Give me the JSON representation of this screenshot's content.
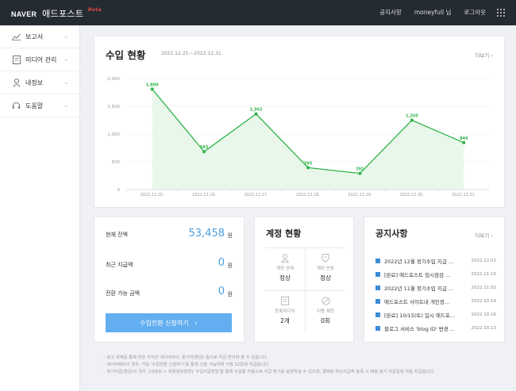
{
  "header": {
    "brand_naver": "NAVER",
    "brand_name": "애드포스트",
    "brand_beta": "Beta",
    "nav": [
      "공지사항",
      "moneyfull 님",
      "로그아웃"
    ]
  },
  "sidebar": {
    "items": [
      {
        "label": "보고서",
        "icon": "chart-line-icon"
      },
      {
        "label": "미디어 관리",
        "icon": "media-icon"
      },
      {
        "label": "내정보",
        "icon": "user-icon"
      },
      {
        "label": "도움말",
        "icon": "headset-icon"
      }
    ]
  },
  "revenue": {
    "title": "수입 현황",
    "period": "2022.12.25.~2022.12.31.",
    "more": "더보기"
  },
  "chart_data": {
    "type": "area",
    "categories": [
      "2022.12.25.",
      "2022.12.26.",
      "2022.12.27.",
      "2022.12.28.",
      "2022.12.29.",
      "2022.12.30.",
      "2022.12.31."
    ],
    "values": [
      1809,
      683,
      1362,
      395,
      291,
      1250,
      844
    ],
    "value_labels": [
      "1,809",
      "683",
      "1,362",
      "395",
      "291",
      "1,250",
      "844"
    ],
    "yticks": [
      "2,000",
      "1,500",
      "1,000",
      "500",
      "0"
    ],
    "ylim": [
      0,
      2000
    ],
    "line_color": "#2fb34a",
    "fill_color": "#e9f7ea"
  },
  "balance": {
    "current_label": "현재 잔액",
    "current_value": "53,458",
    "recent_label": "최근 지급액",
    "recent_value": "0",
    "convertible_label": "전환 가능 금액",
    "convertible_value": "0",
    "unit": "원",
    "button": "수입전환 신청하기"
  },
  "account": {
    "title": "계정 현황",
    "cells": [
      {
        "label": "계정 상태",
        "value": "정상",
        "icon": "person-icon"
      },
      {
        "label": "계좌 번호",
        "value": "정상",
        "icon": "bank-card-icon"
      },
      {
        "label": "등록미디어",
        "value": "2개",
        "icon": "document-icon"
      },
      {
        "label": "이용 제한",
        "value": "0회",
        "icon": "prohibited-icon"
      }
    ]
  },
  "notices": {
    "title": "공지사항",
    "more": "더보기",
    "items": [
      {
        "text": "2022년 12월 정기수입 지급 ...",
        "date": "2022.12.01"
      },
      {
        "text": "[완료] 애드포스트 임시점검 ...",
        "date": "2022.11.16"
      },
      {
        "text": "2022년 11월 정기수입 지급 ...",
        "date": "2022.11.01"
      },
      {
        "text": "애드포스트 사이트내 개인정...",
        "date": "2022.10.19"
      },
      {
        "text": "[완료] 10/15(토) 일시 애드포...",
        "date": "2022.10.16"
      },
      {
        "text": "블로그 서비스 'blog ID' 변경 ...",
        "date": "2022.10.13"
      }
    ]
  },
  "footnotes": [
    "· 광고 게재를 통해 얻은 수익은 네이버와이, 원가지(환금) 등으로 지급 받아야 할 수 있습니다.",
    "· 네이버페이의 경우, 익일 '수입전환 신청하기'를 통해 신청 가능하며 익월 12일에 지급됩니다.",
    "· 정기지급(현금)의 경우, [내정보 > 회원정보변경] '수입지급방법'을 통해 수입을 자동으로 지급 받기를 설정하실 수 있으며, 결제된 최소지급액 충족 시 매월 정기 지급일에 자동 지급됩니다."
  ]
}
